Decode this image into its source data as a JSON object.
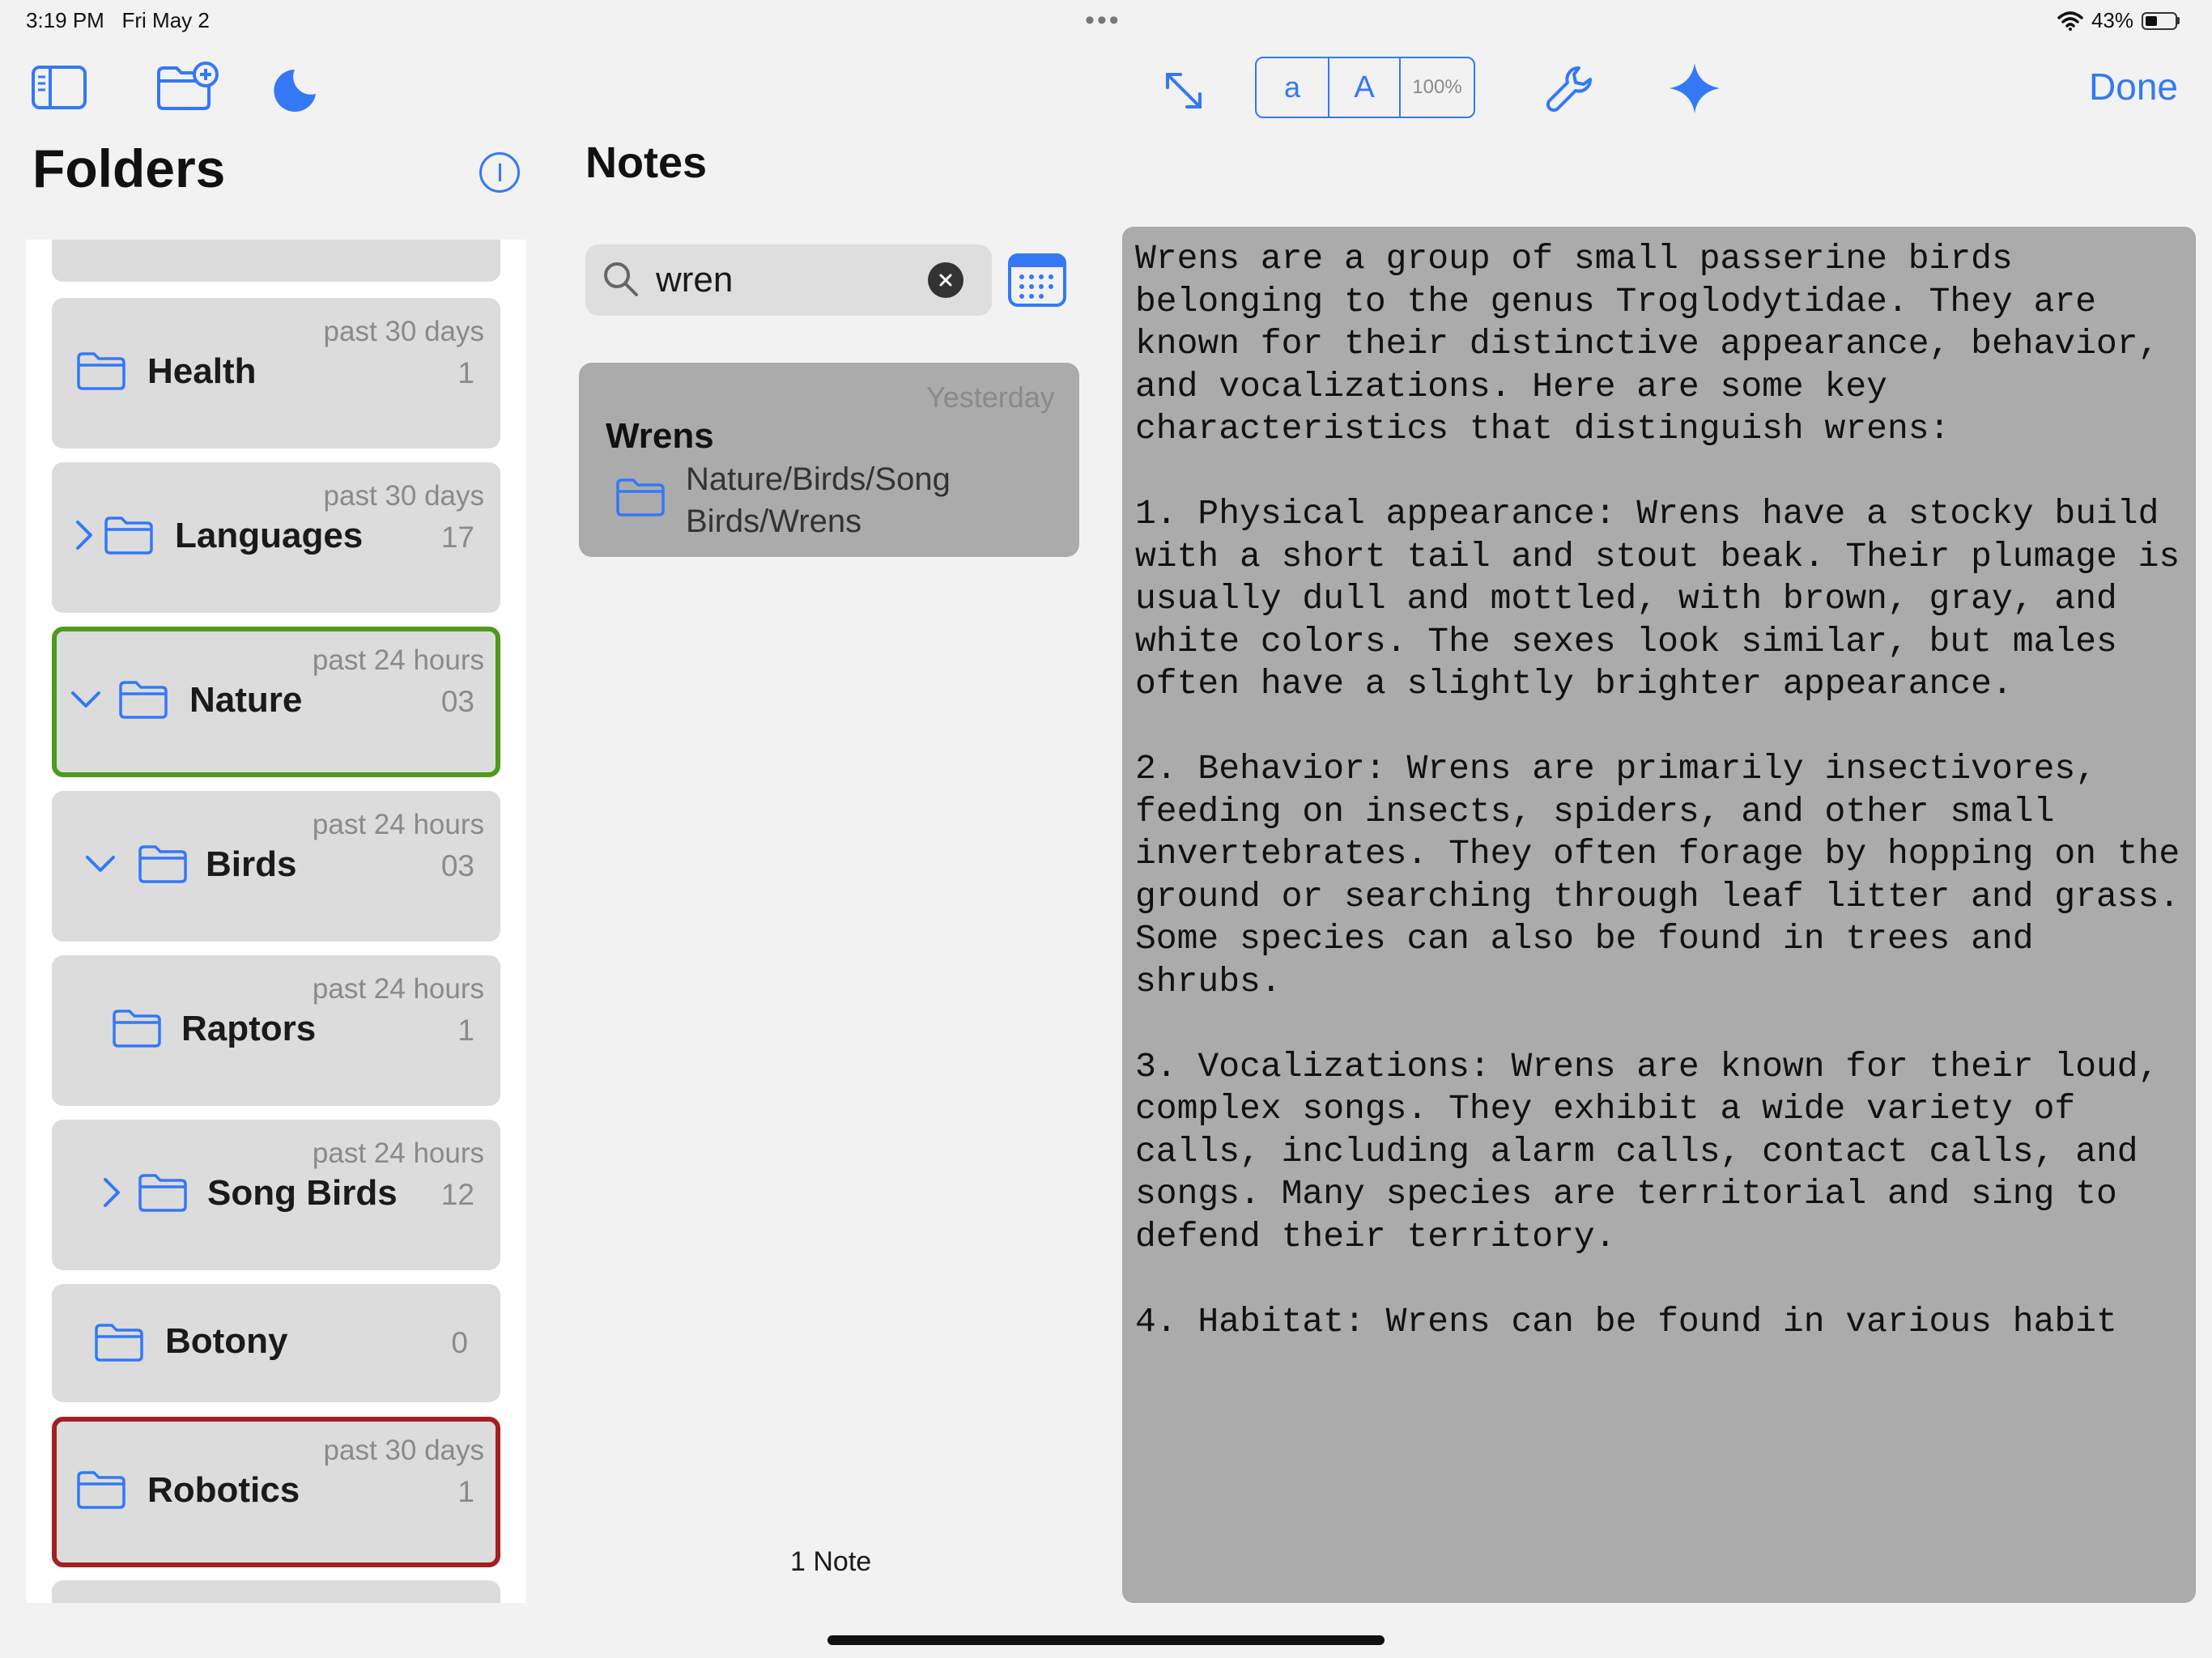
{
  "status_bar": {
    "time": "3:19 PM",
    "date": "Fri May 2",
    "battery": "43%",
    "icons": [
      "wifi-icon",
      "battery-icon",
      "more-dots-icon"
    ]
  },
  "toolbar": {
    "font_small": "a",
    "font_large": "A",
    "zoom": "100%",
    "done_label": "Done",
    "accent_color": "#3478f6",
    "icons": [
      "sidebar-icon",
      "new-folder-icon",
      "moon-icon",
      "expand-icon",
      "wrench-icon",
      "sparkle-icon"
    ]
  },
  "folders": {
    "title": "Folders",
    "items": [
      {
        "name": "Health",
        "when": "past 30 days",
        "count": "1",
        "chevron": "none"
      },
      {
        "name": "Languages",
        "when": "past 30 days",
        "count": "17",
        "chevron": "right"
      },
      {
        "name": "Nature",
        "when": "past 24 hours",
        "count": "03",
        "chevron": "down"
      },
      {
        "name": "Birds",
        "when": "past 24 hours",
        "count": "03",
        "chevron": "down"
      },
      {
        "name": "Raptors",
        "when": "past 24 hours",
        "count": "1",
        "chevron": "none"
      },
      {
        "name": "Song Birds",
        "when": "past 24 hours",
        "count": "12",
        "chevron": "right"
      },
      {
        "name": "Botony",
        "when": "",
        "count": "0",
        "chevron": "none"
      },
      {
        "name": "Robotics",
        "when": "past 30 days",
        "count": "1",
        "chevron": "none"
      }
    ]
  },
  "notes": {
    "title": "Notes",
    "search": {
      "value": "wren"
    },
    "results": [
      {
        "date": "Yesterday",
        "title": "Wrens",
        "path": "Nature/Birds/Song Birds/Wrens"
      }
    ],
    "count_label": "1 Note"
  },
  "editor": {
    "body": "Wrens are a group of small passerine birds belonging to the genus Troglodytidae. They are known for their distinctive appearance, behavior, and vocalizations. Here are some key characteristics that distinguish wrens:\n\n1. Physical appearance: Wrens have a stocky build with a short tail and stout beak. Their plumage is usually dull and mottled, with brown, gray, and white colors. The sexes look similar, but males often have a slightly brighter appearance.\n\n2. Behavior: Wrens are primarily insectivores, feeding on insects, spiders, and other small invertebrates. They often forage by hopping on the ground or searching through leaf litter and grass. Some species can also be found in trees and shrubs.\n\n3. Vocalizations: Wrens are known for their loud, complex songs. They exhibit a wide variety of calls, including alarm calls, contact calls, and songs. Many species are territorial and sing to defend their territory.\n\n4. Habitat: Wrens can be found in various habit"
  }
}
